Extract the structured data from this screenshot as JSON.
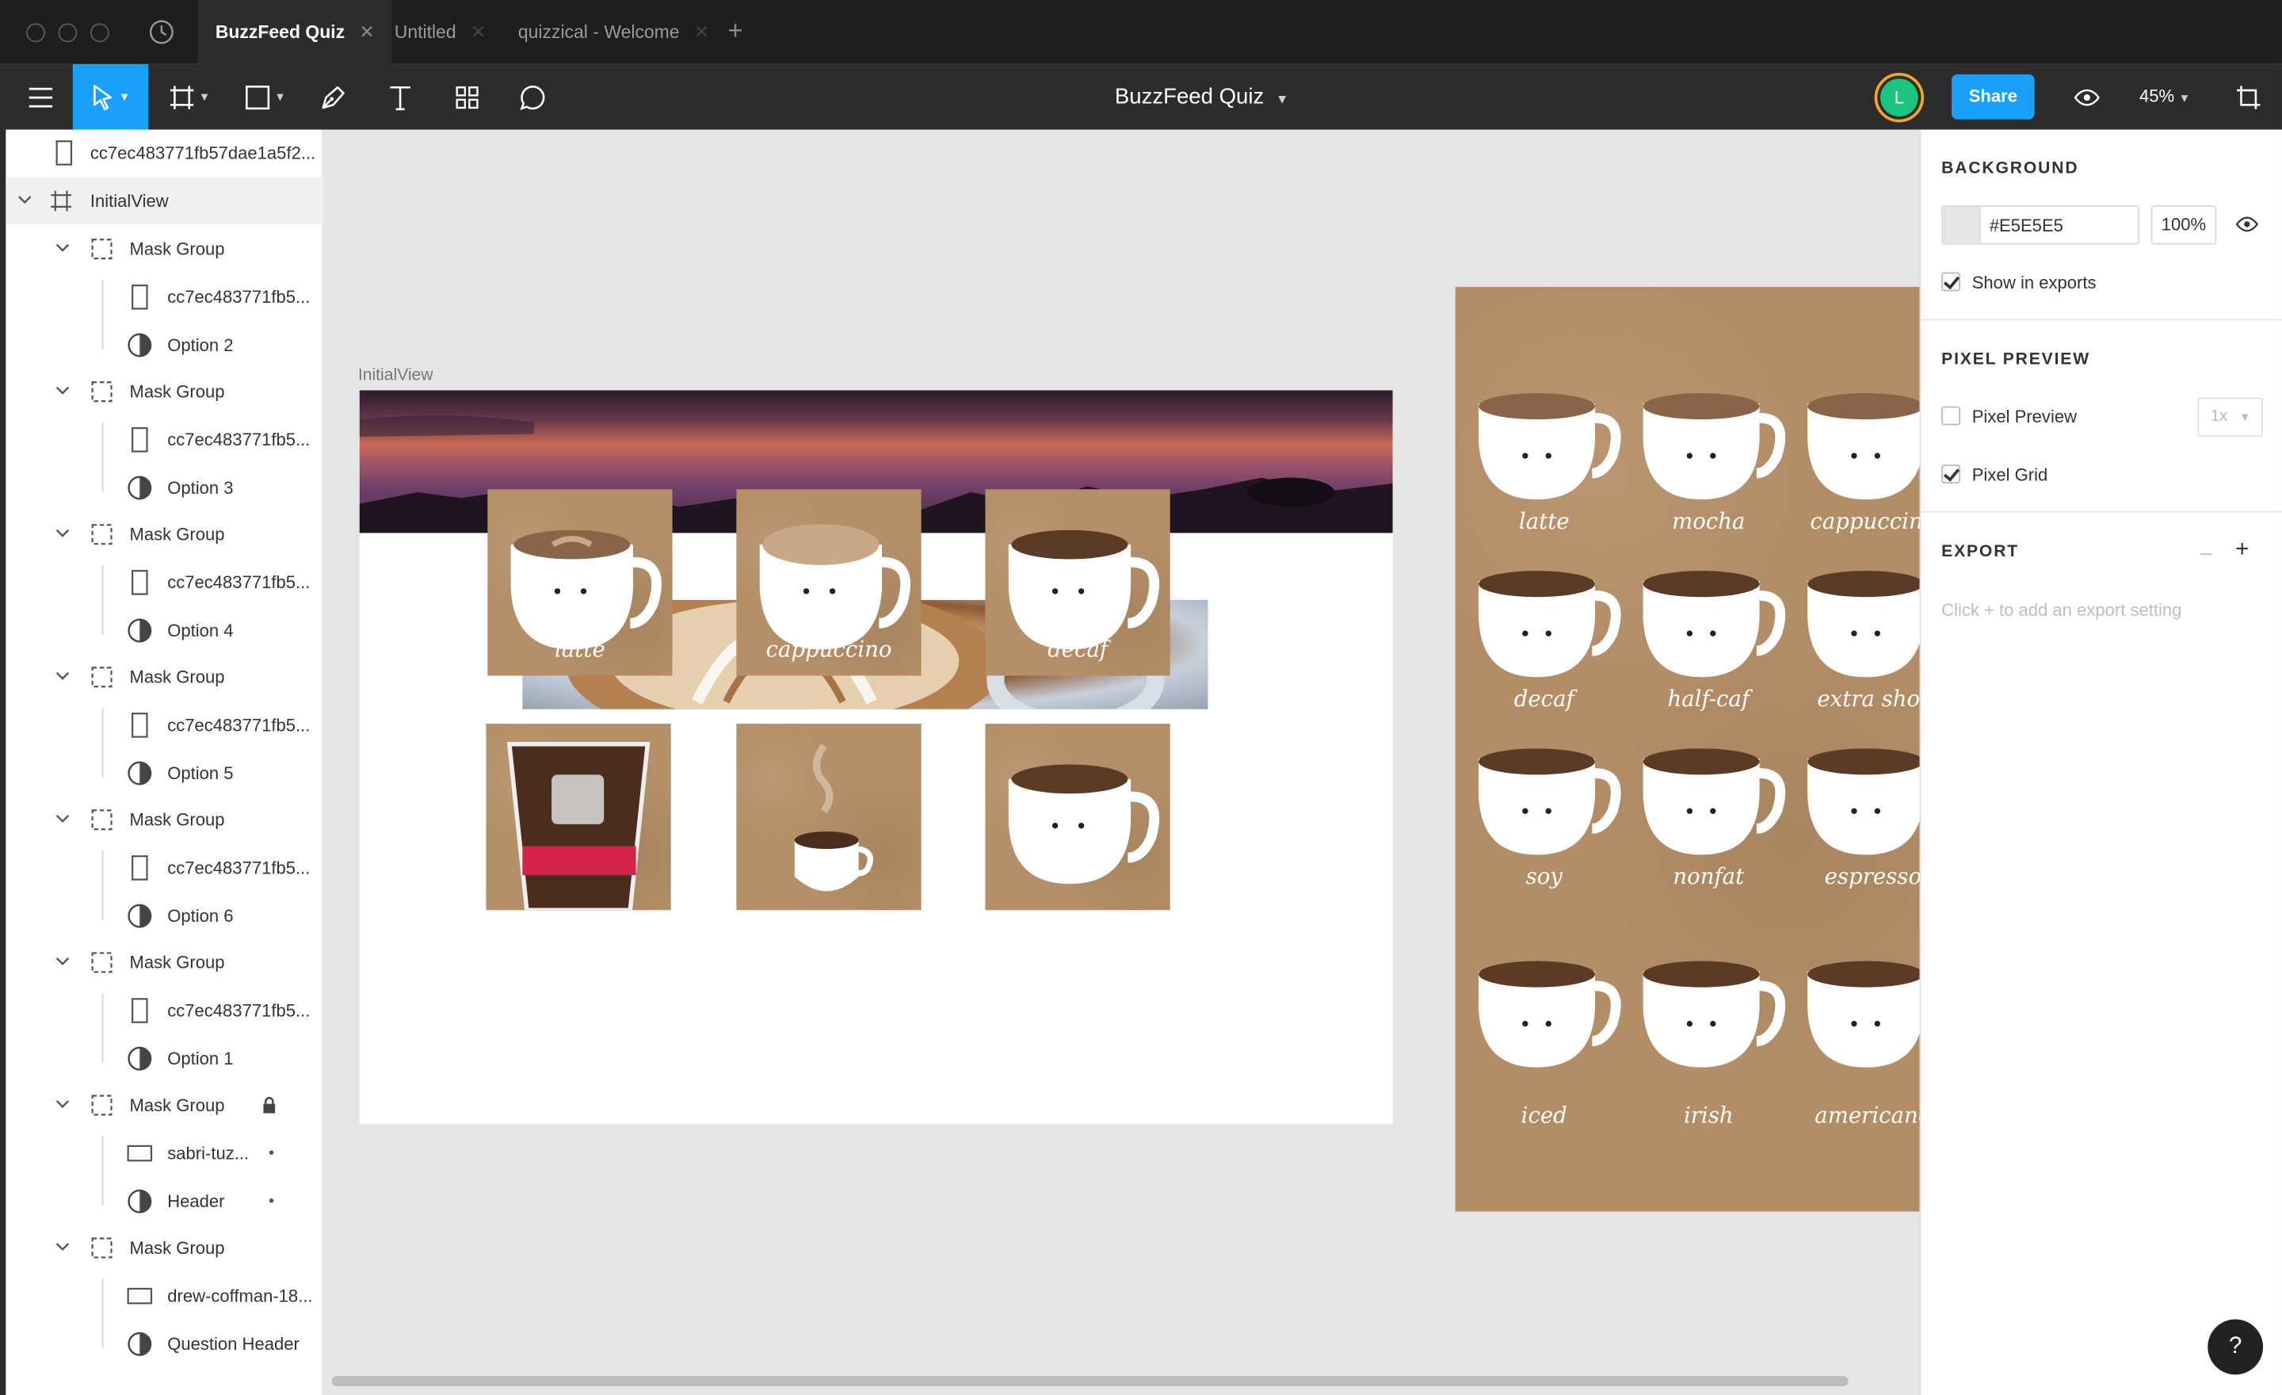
{
  "tabs": [
    {
      "label": "BuzzFeed Quiz",
      "active": true
    },
    {
      "label": "Untitled",
      "active": false
    },
    {
      "label": "quizzical - Welcome",
      "active": false
    }
  ],
  "toolbar": {
    "file_title": "BuzzFeed Quiz",
    "avatar_initial": "L",
    "share_label": "Share",
    "zoom_label": "45%"
  },
  "layers": {
    "top_item": "cc7ec483771fb57dae1a5f2...",
    "frame_name": "InitialView",
    "groups": [
      {
        "label": "Mask Group",
        "children": [
          "cc7ec483771fb5...",
          "Option 2"
        ]
      },
      {
        "label": "Mask Group",
        "children": [
          "cc7ec483771fb5...",
          "Option 3"
        ]
      },
      {
        "label": "Mask Group",
        "children": [
          "cc7ec483771fb5...",
          "Option 4"
        ]
      },
      {
        "label": "Mask Group",
        "children": [
          "cc7ec483771fb5...",
          "Option 5"
        ]
      },
      {
        "label": "Mask Group",
        "children": [
          "cc7ec483771fb5...",
          "Option 6"
        ]
      },
      {
        "label": "Mask Group",
        "children": [
          "cc7ec483771fb5...",
          "Option 1"
        ]
      },
      {
        "label": "Mask Group",
        "children": [
          "sabri-tuz...",
          "Header"
        ]
      },
      {
        "label": "Mask Group",
        "children": [
          "drew-coffman-18...",
          "Question Header"
        ]
      }
    ]
  },
  "canvas": {
    "frame_label": "InitialView",
    "cards": [
      "latte",
      "cappuccino",
      "decaf",
      "",
      "",
      ""
    ],
    "right_art_labels": [
      "latte",
      "mocha",
      "cappuccino",
      "decaf",
      "half-caf",
      "extra shot",
      "soy",
      "nonfat",
      "espresso",
      "iced",
      "irish",
      "americano"
    ]
  },
  "properties": {
    "background": {
      "title": "BACKGROUND",
      "hex": "#E5E5E5",
      "opacity": "100%",
      "show_in_exports_label": "Show in exports",
      "show_in_exports": true
    },
    "pixel_preview": {
      "title": "PIXEL PREVIEW",
      "pixel_preview_label": "Pixel Preview",
      "pixel_preview": false,
      "scale": "1x",
      "pixel_grid_label": "Pixel Grid",
      "pixel_grid": true
    },
    "export": {
      "title": "EXPORT",
      "hint": "Click + to add an export setting"
    }
  },
  "colors": {
    "accent": "#18A0FB",
    "avatar": "#1BC47D",
    "avatar_ring": "#F5A623",
    "toolbar": "#2C2C2C",
    "canvas": "#E5E5E5"
  },
  "help_label": "?"
}
